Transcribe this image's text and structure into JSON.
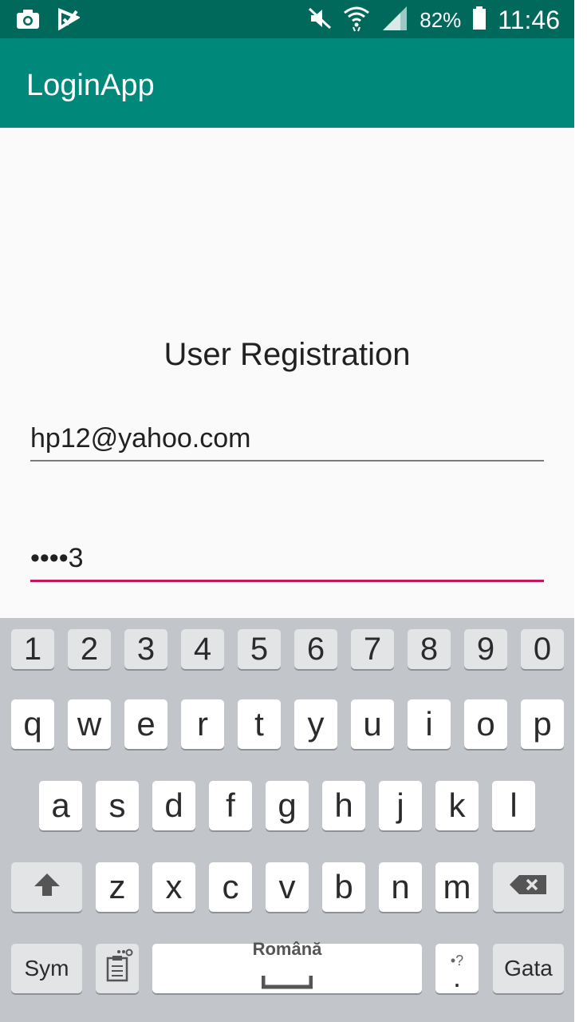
{
  "statusbar": {
    "battery": "82%",
    "time": "11:46",
    "icons": [
      "camera-icon",
      "checkmark-notification-icon",
      "mute-icon",
      "wifi-icon",
      "signal-icon",
      "battery-icon"
    ]
  },
  "appbar": {
    "title": "LoginApp"
  },
  "form": {
    "title": "User Registration",
    "email_value": "hp12@yahoo.com",
    "password_value": "••••3"
  },
  "colors": {
    "statusbar": "#00695c",
    "appbar": "#00897b",
    "focus_underline": "#c2185b",
    "keyboard_bg": "#c2c5c9"
  },
  "keyboard": {
    "numbers": [
      "1",
      "2",
      "3",
      "4",
      "5",
      "6",
      "7",
      "8",
      "9",
      "0"
    ],
    "row1": [
      "q",
      "w",
      "e",
      "r",
      "t",
      "y",
      "u",
      "i",
      "o",
      "p"
    ],
    "row2": [
      "a",
      "s",
      "d",
      "f",
      "g",
      "h",
      "j",
      "k",
      "l"
    ],
    "row3": [
      "z",
      "x",
      "c",
      "v",
      "b",
      "n",
      "m"
    ],
    "sym": "Sym",
    "space": "Română",
    "period": ".",
    "period_hint": "•?",
    "done": "Gata"
  }
}
